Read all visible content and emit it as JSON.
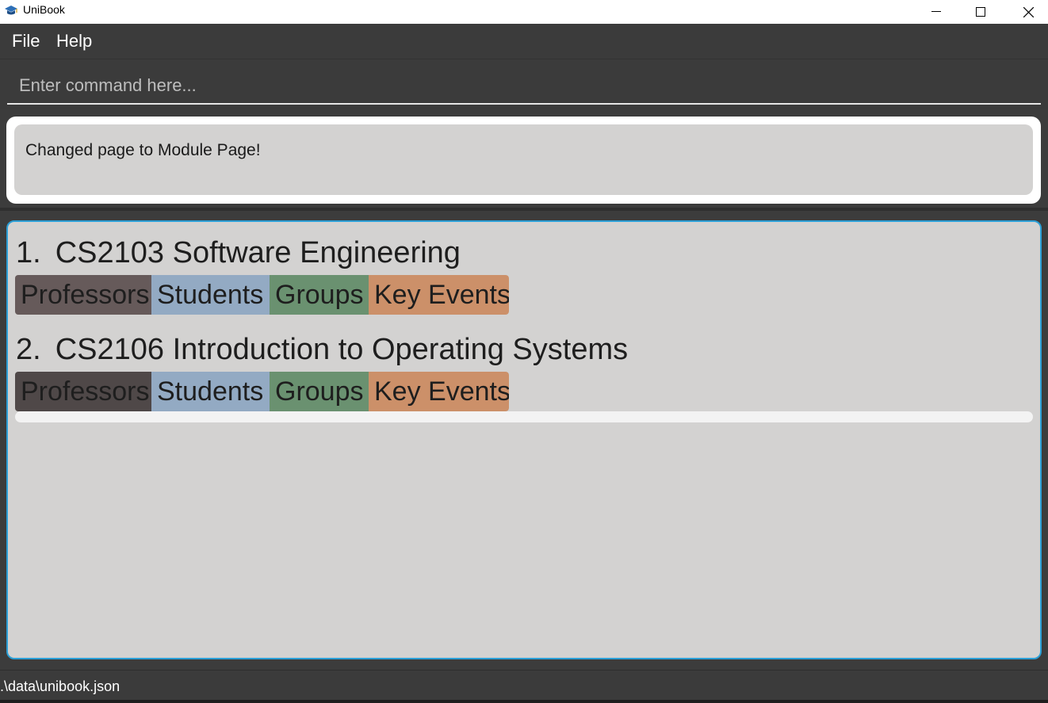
{
  "window": {
    "title": "UniBook",
    "icon": "graduation-cap-icon"
  },
  "menu": {
    "items": [
      "File",
      "Help"
    ]
  },
  "command": {
    "placeholder": "Enter command here...",
    "value": ""
  },
  "result": {
    "message": "Changed page to Module Page!"
  },
  "modules": [
    {
      "index": "1.",
      "code": "CS2103",
      "name": "Software Engineering",
      "tags": [
        "Professors",
        "Students",
        "Groups",
        "Key Events"
      ]
    },
    {
      "index": "2.",
      "code": "CS2106",
      "name": "Introduction to Operating Systems",
      "tags": [
        "Professors",
        "Students",
        "Groups",
        "Key Events"
      ]
    }
  ],
  "status": {
    "path": ".\\data\\unibook.json"
  },
  "colors": {
    "professors": "#665a5a",
    "students": "#93aac3",
    "groups": "#6a9170",
    "key_events": "#cc9069",
    "panel_border": "#2b9fd6"
  }
}
